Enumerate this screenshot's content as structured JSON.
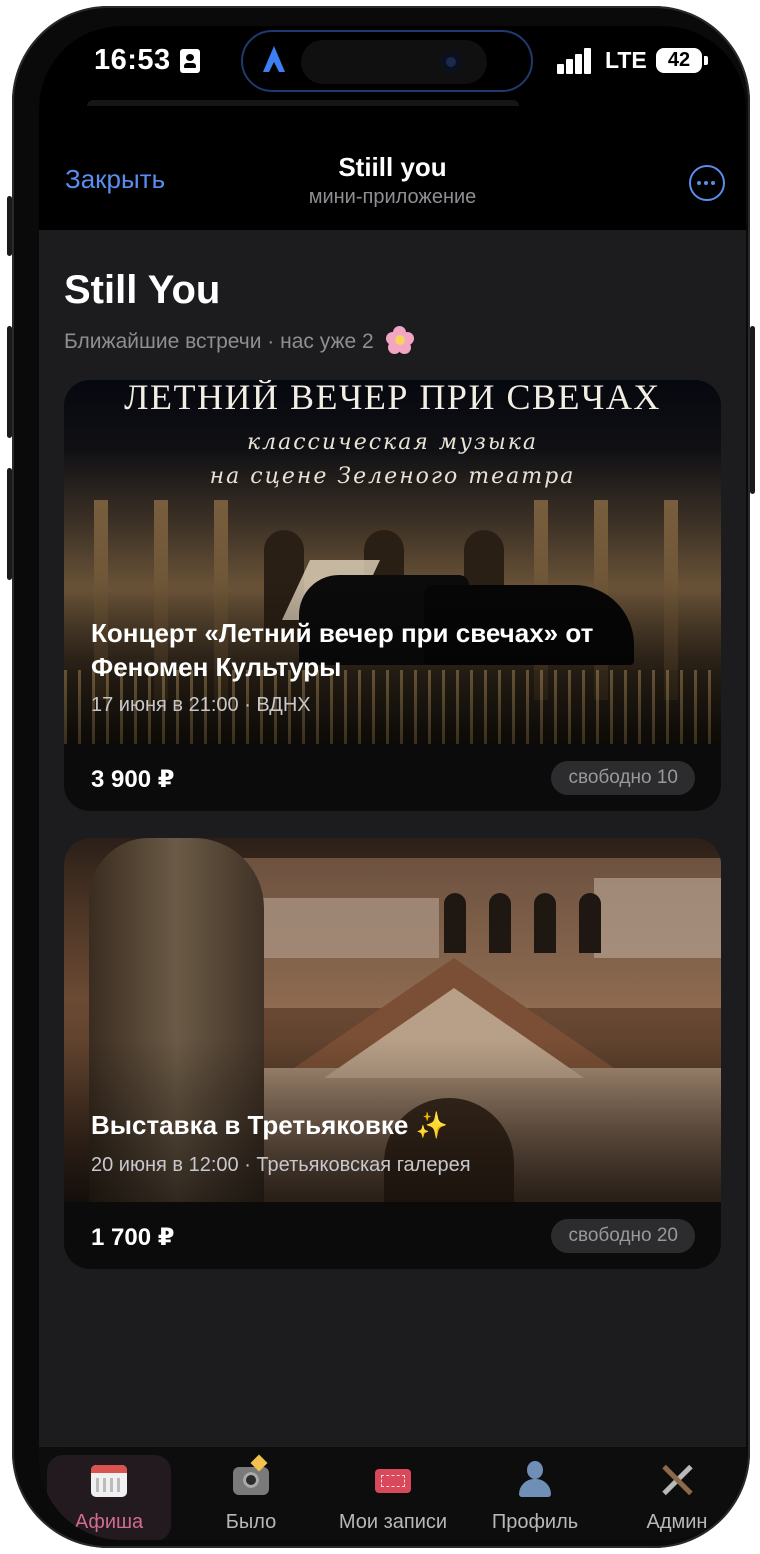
{
  "status_bar": {
    "time": "16:53",
    "network": "LTE",
    "battery": "42"
  },
  "mini_app_header": {
    "close_label": "Закрыть",
    "title": "Stiill you",
    "subtitle": "мини-приложение"
  },
  "main": {
    "title": "Still You",
    "subtitle": "Ближайшие встречи · нас уже 2",
    "events": [
      {
        "image_headline": "ЛЕТНИЙ ВЕЧЕР ПРИ СВЕЧАХ",
        "image_subline_1": "классическая музыка",
        "image_subline_2": "на сцене Зеленого театра",
        "title": "Концерт «Летний вечер при свечах» от Феномен Культуры",
        "meta": "17 июня в 21:00 · ВДНХ",
        "price": "3 900 ₽",
        "availability": "свободно 10"
      },
      {
        "title": "Выставка в Третьяковке ✨",
        "meta": "20 июня в 12:00 · Третьяковская галерея",
        "price": "1 700 ₽",
        "availability": "свободно 20"
      }
    ]
  },
  "tab_bar": {
    "tabs": [
      {
        "label": "Афиша",
        "icon": "calendar-icon",
        "active": true
      },
      {
        "label": "Было",
        "icon": "camera-flash-icon",
        "active": false
      },
      {
        "label": "Мои записи",
        "icon": "ticket-icon",
        "active": false
      },
      {
        "label": "Профиль",
        "icon": "user-silhouette-icon",
        "active": false
      },
      {
        "label": "Админ",
        "icon": "tools-icon",
        "active": false
      }
    ]
  },
  "colors": {
    "accent": "#5b8def",
    "background": "#1c1c1e",
    "active_tab": "#d06b8f"
  }
}
